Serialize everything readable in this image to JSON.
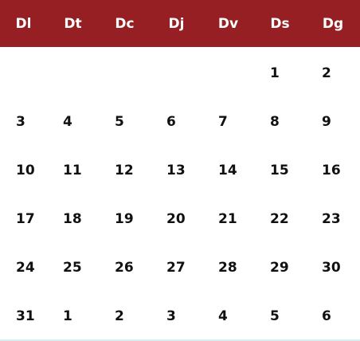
{
  "calendar": {
    "weekdays": [
      "Dl",
      "Dt",
      "Dc",
      "Dj",
      "Dv",
      "Ds",
      "Dg"
    ],
    "weeks": [
      [
        "",
        "",
        "",
        "",
        "",
        "1",
        "2"
      ],
      [
        "3",
        "4",
        "5",
        "6",
        "7",
        "8",
        "9"
      ],
      [
        "10",
        "11",
        "12",
        "13",
        "14",
        "15",
        "16"
      ],
      [
        "17",
        "18",
        "19",
        "20",
        "21",
        "22",
        "23"
      ],
      [
        "24",
        "25",
        "26",
        "27",
        "28",
        "29",
        "30"
      ],
      [
        "31",
        "1",
        "2",
        "3",
        "4",
        "5",
        "6"
      ]
    ]
  },
  "colors": {
    "header_background": "#951f22",
    "header_text": "#ffffff",
    "day_text": "#111111"
  }
}
